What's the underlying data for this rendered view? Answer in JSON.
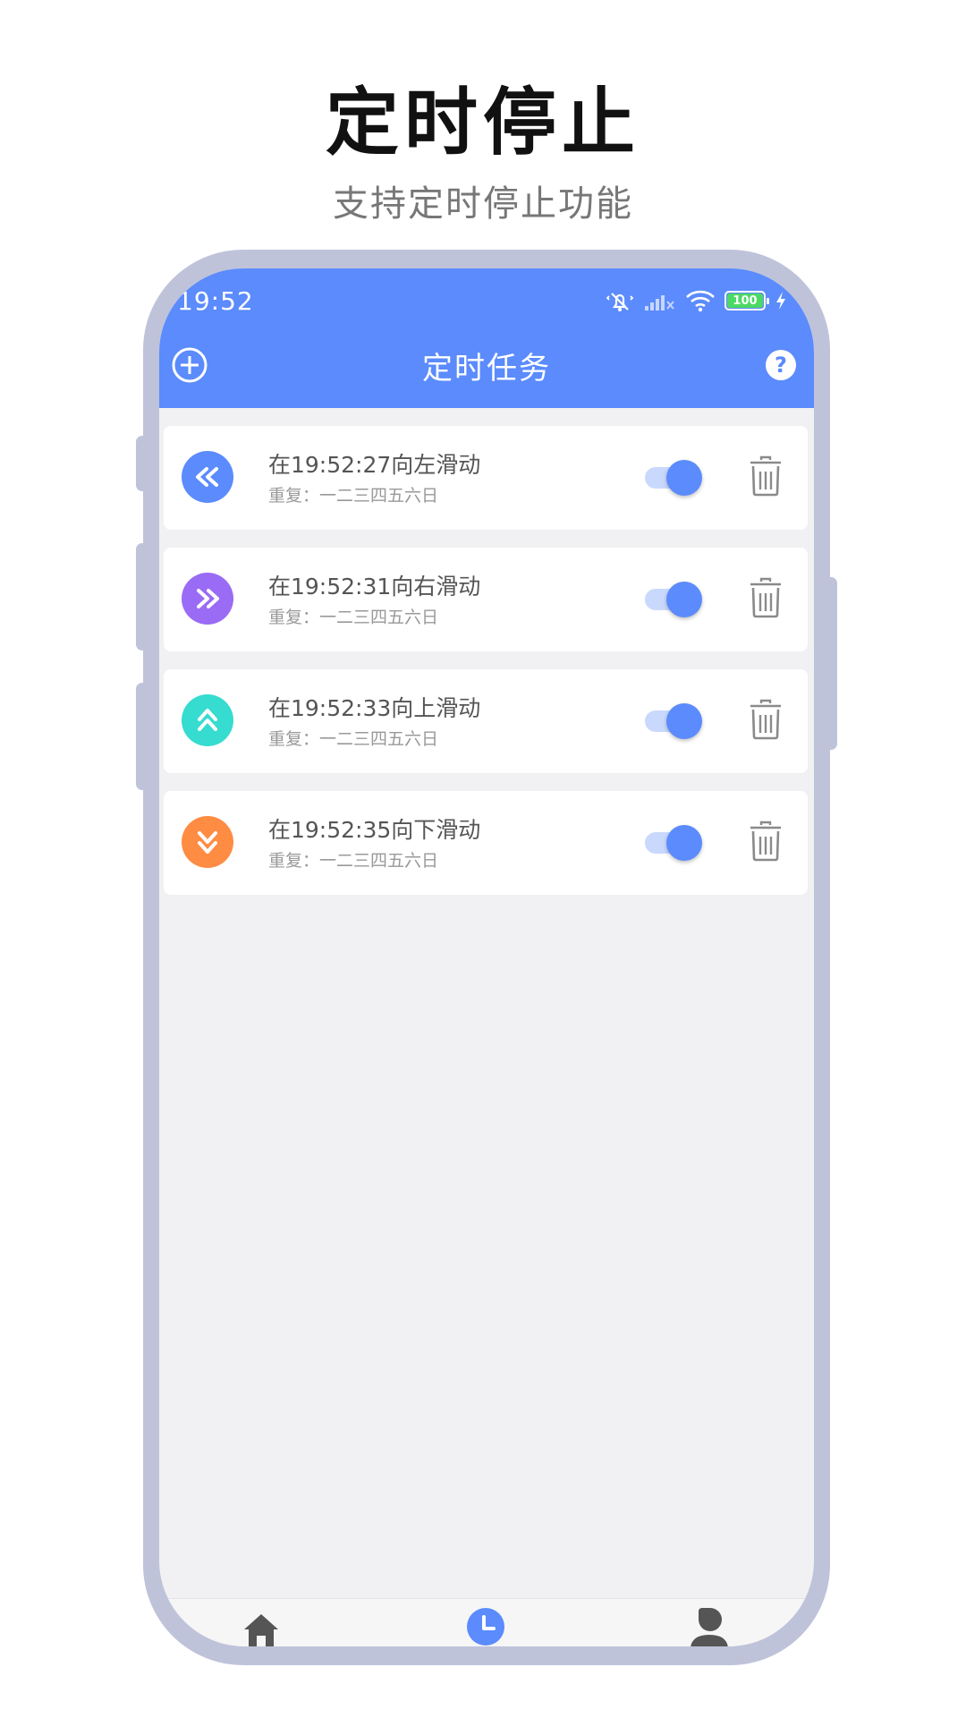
{
  "promo": {
    "title": "定时停止",
    "subtitle": "支持定时停止功能"
  },
  "status_bar": {
    "time": "19:52",
    "battery": "100",
    "icons": [
      "mute-icon",
      "signal-icon",
      "wifi-icon",
      "battery-icon",
      "charging-icon"
    ]
  },
  "toolbar": {
    "title": "定时任务",
    "add_icon": "add-circle-icon",
    "help_label": "?"
  },
  "tasks": [
    {
      "title": "在19:52:27向左滑动",
      "repeat": "重复：一二三四五六日",
      "direction": "left",
      "color": "#5b8bfc",
      "enabled": true
    },
    {
      "title": "在19:52:31向右滑动",
      "repeat": "重复：一二三四五六日",
      "direction": "right",
      "color": "#9a6bf5",
      "enabled": true
    },
    {
      "title": "在19:52:33向上滑动",
      "repeat": "重复：一二三四五六日",
      "direction": "up",
      "color": "#35dccf",
      "enabled": true
    },
    {
      "title": "在19:52:35向下滑动",
      "repeat": "重复：一二三四五六日",
      "direction": "down",
      "color": "#ff8c43",
      "enabled": true
    }
  ],
  "bottom_nav": {
    "items": [
      "home-icon",
      "clock-icon",
      "profile-icon"
    ],
    "active_color": "#5b8bfc"
  },
  "colors": {
    "primary": "#5b8bfc",
    "frame": "#bfc3da",
    "background": "#f1f1f3"
  }
}
